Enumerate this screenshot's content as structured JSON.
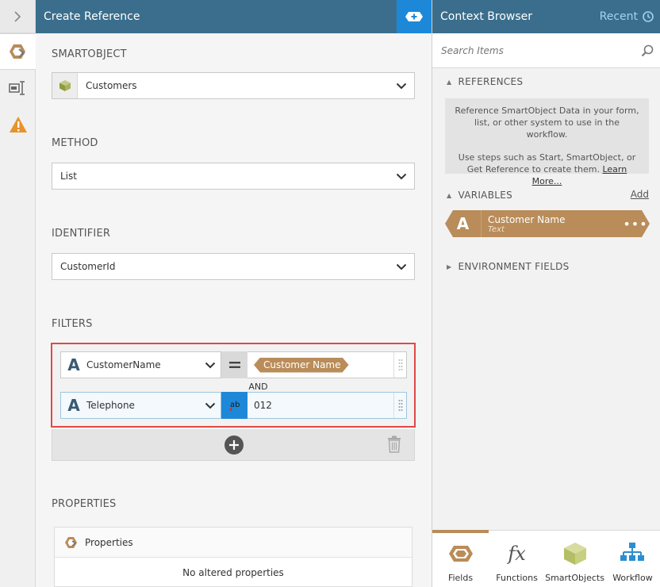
{
  "main": {
    "title": "Create Reference",
    "smartobject": {
      "label": "SMARTOBJECT",
      "value": "Customers"
    },
    "method": {
      "label": "METHOD",
      "value": "List"
    },
    "identifier": {
      "label": "IDENTIFIER",
      "value": "CustomerId"
    },
    "filters": {
      "label": "FILTERS",
      "rows": [
        {
          "field": "CustomerName",
          "operator_icon": "equals-icon",
          "value_chip": "Customer Name"
        },
        {
          "field": "Telephone",
          "operator_icon": "text-operator-icon",
          "value": "012"
        }
      ],
      "conjunction": "AND"
    },
    "properties": {
      "label": "PROPERTIES",
      "header": "Properties",
      "empty": "No altered properties"
    }
  },
  "context": {
    "title": "Context Browser",
    "recent": "Recent",
    "search_placeholder": "Search Items",
    "references": {
      "label": "REFERENCES",
      "info_line1": "Reference SmartObject Data in your form, list, or other system to use in the workflow.",
      "info_line2": "Use steps such as Start, SmartObject, or Get Reference to create them.",
      "learn_more": "Learn More..."
    },
    "variables": {
      "label": "VARIABLES",
      "add": "Add",
      "items": [
        {
          "name": "Customer Name",
          "type": "Text"
        }
      ]
    },
    "environment": {
      "label": "ENVIRONMENT FIELDS"
    },
    "tabs": [
      {
        "label": "Fields",
        "icon": "fields-icon"
      },
      {
        "label": "Functions",
        "icon": "functions-icon"
      },
      {
        "label": "SmartObjects",
        "icon": "smartobjects-icon"
      },
      {
        "label": "Workflow",
        "icon": "workflow-icon"
      }
    ]
  },
  "colors": {
    "header": "#3b6e8c",
    "accent_blue": "#1e88d8",
    "chip_tan": "#b98c59",
    "highlight_red": "#e04848"
  }
}
